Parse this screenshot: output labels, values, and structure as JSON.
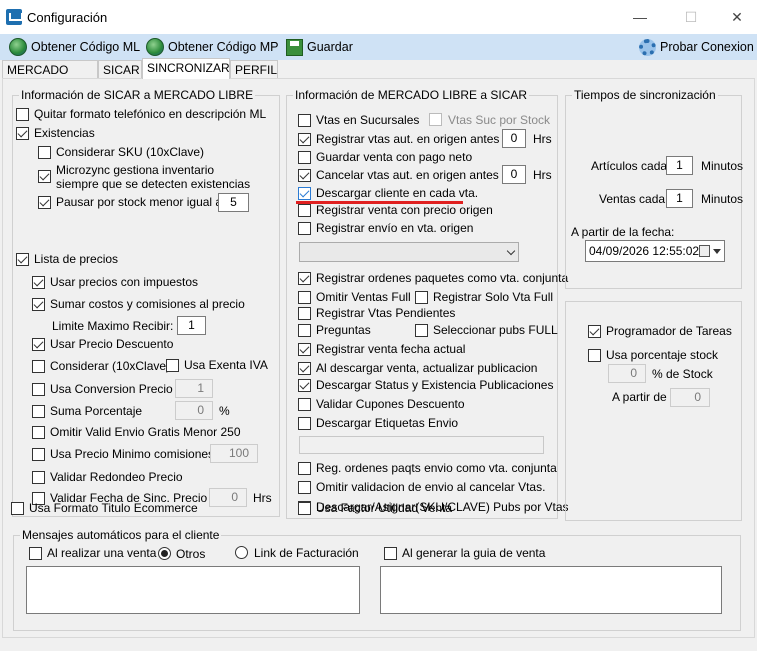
{
  "window": {
    "title": "Configuración",
    "min_glyph": "—",
    "max_glyph": "☐",
    "close_glyph": "✕"
  },
  "toolbar": {
    "ml_code": "Obtener Código ML",
    "mp_code": "Obtener Código MP",
    "save": "Guardar",
    "test": "Probar Conexion"
  },
  "tabs": [
    "MERCADO LIBRE",
    "SICAR",
    "SINCRONIZAR",
    "PERFIL"
  ],
  "sicar_to_ml": {
    "legend": "Información de SICAR a MERCADO LIBRE",
    "quitar_formato": "Quitar formato telefónico en descripción ML",
    "existencias": "Existencias",
    "sku": "Considerar SKU (10xClave)",
    "microzync_1": "Microzync gestiona inventario",
    "microzync_2": "siempre que se detecten existencias",
    "pausar": "Pausar por stock menor igual a:",
    "pausar_value": "5",
    "lista_precios": "Lista de precios",
    "impuestos": "Usar precios con impuestos",
    "sumar_costos": "Sumar costos y comisiones al precio",
    "limite": "Limite Maximo Recibir:",
    "limite_value": "1",
    "precio_descuento": "Usar Precio Descuento",
    "considerar_10x": "Considerar (10xClave)",
    "exenta_iva": "Usa Exenta IVA",
    "conversion": "Usa Conversion Precio",
    "conversion_value": "1",
    "suma_pct": "Suma Porcentaje",
    "suma_pct_value": "0",
    "pct_sign": "%",
    "omitir_envio": "Omitir Valid Envio Gratis Menor 250",
    "precio_minimo": "Usa Precio Minimo comisiones",
    "precio_minimo_value": "100",
    "redondeo": "Validar Redondeo Precio",
    "fecha_sinc": "Validar Fecha de Sinc. Precio",
    "fecha_sinc_value": "0",
    "hrs": "Hrs",
    "formato_titulo": "Usa Formato Titulo Ecommerce"
  },
  "ml_to_sicar": {
    "legend": "Información de MERCADO LIBRE a SICAR",
    "vtas_sucursales": "Vtas en Sucursales",
    "vtas_suc_stock": "Vtas Suc por Stock",
    "registrar_vtas": "Registrar vtas aut. en origen antes de:",
    "registrar_vtas_value": "0",
    "guardar_pago": "Guardar venta con pago neto",
    "cancelar_vtas": "Cancelar vtas aut. en origen antes de:",
    "cancelar_vtas_value": "0",
    "hrs": "Hrs",
    "descargar_cliente": "Descargar cliente en cada vta.",
    "precio_origen": "Registrar venta con precio origen",
    "envio_origen": "Registrar envío en vta. origen",
    "paquetes": "Registrar ordenes paquetes como vta. conjunta",
    "omitir_full": "Omitir Ventas Full",
    "solo_vta_full": "Registrar Solo Vta Full",
    "pendientes": "Registrar Vtas Pendientes",
    "preguntas": "Preguntas",
    "pubs_full": "Seleccionar pubs FULL",
    "fecha_actual": "Registrar venta fecha actual",
    "actualizar_pub": "Al descargar venta, actualizar publicacion",
    "status_existencia": "Descargar Status y Existencia Publicaciones",
    "cupones": "Validar Cupones Descuento",
    "etiquetas": "Descargar Etiquetas Envio",
    "reg_paqts": "Reg. ordenes paqts envio como vta. conjunta",
    "omitir_validacion": "Omitir validacion de envio al cancelar Vtas.",
    "asignar_sku": "Descargar/Asignar(SKU/CLAVE) Pubs por Vtas",
    "factor_utilidad": "Usa Factor Utilidad Venta"
  },
  "sync_times": {
    "legend": "Tiempos de sincronización",
    "articulos": "Artículos cada",
    "articulos_value": "1",
    "ventas": "Ventas cada",
    "ventas_value": "1",
    "minutos": "Minutos",
    "desde": "A partir de la fecha:",
    "fecha": "04/09/2026 12:55:02"
  },
  "tareas": {
    "programador": "Programador de Tareas",
    "porcentaje_stock": "Usa porcentaje stock",
    "pct_value": "0",
    "pct_de": "% de  Stock",
    "a_partir": "A partir de",
    "a_partir_value": "0"
  },
  "mensajes": {
    "legend": "Mensajes automáticos para el cliente",
    "al_realizar": "Al realizar una venta",
    "otros": "Otros",
    "link_facturacion": "Link de Facturación",
    "al_generar": "Al generar la guia de venta"
  }
}
